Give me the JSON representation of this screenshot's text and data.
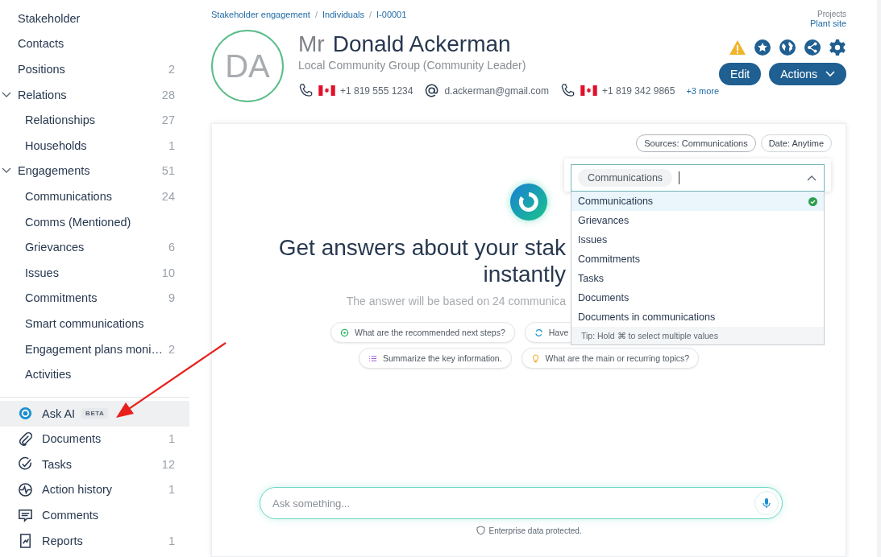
{
  "sidebar": {
    "items": [
      {
        "label": "Stakeholder"
      },
      {
        "label": "Contacts"
      },
      {
        "label": "Positions",
        "count": "2"
      },
      {
        "label": "Relations",
        "count": "28",
        "expanded": true,
        "children": [
          {
            "label": "Relationships",
            "count": "27"
          },
          {
            "label": "Households",
            "count": "1"
          }
        ]
      },
      {
        "label": "Engagements",
        "count": "51",
        "expanded": true,
        "children": [
          {
            "label": "Communications",
            "count": "24"
          },
          {
            "label": "Comms (Mentioned)"
          },
          {
            "label": "Grievances",
            "count": "6"
          },
          {
            "label": "Issues",
            "count": "10"
          },
          {
            "label": "Commitments",
            "count": "9"
          },
          {
            "label": "Smart communications"
          },
          {
            "label": "Engagement plans moni…",
            "count": "2"
          },
          {
            "label": "Activities"
          }
        ]
      }
    ],
    "tools": [
      {
        "label": "Ask AI",
        "badge": "BETA",
        "selected": true
      },
      {
        "label": "Documents",
        "count": "1",
        "selected": false
      },
      {
        "label": "Tasks",
        "count": "12",
        "selected": false
      },
      {
        "label": "Action history",
        "count": "1",
        "selected": false
      },
      {
        "label": "Comments",
        "selected": false
      },
      {
        "label": "Reports",
        "count": "1",
        "selected": false
      }
    ]
  },
  "breadcrumb": [
    "Stakeholder engagement",
    "/",
    "Individuals",
    "/",
    "I-00001"
  ],
  "projects": {
    "label": "Projects",
    "value": "Plant site"
  },
  "profile": {
    "initials": "DA",
    "salutation": "Mr",
    "name": "Donald Ackerman",
    "organization": "Local Community Group (Community Leader)",
    "contacts": [
      {
        "kind": "phone",
        "value": "+1 819 555 1234"
      },
      {
        "kind": "email",
        "value": "d.ackerman@gmail.com"
      },
      {
        "kind": "phone",
        "value": "+1 819 342 9865"
      }
    ],
    "more": "+3 more"
  },
  "buttons": {
    "edit": "Edit",
    "actions": "Actions"
  },
  "filters": [
    {
      "label": "Sources: Communications",
      "selected": true
    },
    {
      "label": "Date: Anytime",
      "selected": false
    }
  ],
  "hero": {
    "heading_line1": "Get answers about your stak",
    "heading_line2": "instantly",
    "subtitle": "The answer will be based on 24 communica"
  },
  "suggestions": [
    [
      {
        "text": "What are the recommended next steps?"
      },
      {
        "text": "Have"
      }
    ],
    [
      {
        "text": "Summarize the key information."
      },
      {
        "text": "What are the main or recurring topics?"
      }
    ]
  ],
  "dropdown": {
    "tag": "Communications",
    "options": [
      {
        "label": "Communications",
        "selected": true
      },
      {
        "label": "Grievances",
        "selected": false
      },
      {
        "label": "Issues",
        "selected": false
      },
      {
        "label": "Commitments",
        "selected": false
      },
      {
        "label": "Tasks",
        "selected": false
      },
      {
        "label": "Documents",
        "selected": false
      },
      {
        "label": "Documents in communications",
        "selected": false
      }
    ],
    "tip": "Tip: Hold ⌘ to select multiple values"
  },
  "ask": {
    "placeholder": "Ask something...",
    "note": "Enterprise data protected."
  }
}
